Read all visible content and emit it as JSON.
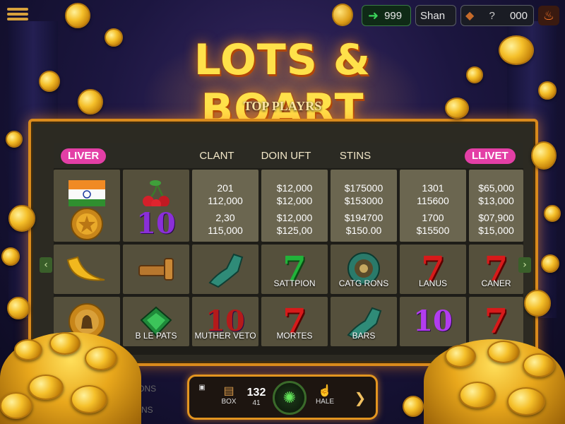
{
  "topbar": {
    "balance": "999",
    "player_name": "Shan",
    "help": "?",
    "gems": "000"
  },
  "title": "LOTS & BOART",
  "subtitle": "TOP PLAYRS",
  "board": {
    "header": {
      "left_tag": "LIVER",
      "columns": [
        "CLANT",
        "DOIN UFT",
        "STINS"
      ],
      "right_tag": "LLIVET"
    },
    "value_rows": [
      {
        "values": [
          [
            "201",
            "112,000"
          ],
          [
            "$12,000",
            "$12,000"
          ],
          [
            "$175000",
            "$153000"
          ],
          [
            "1301",
            "115600"
          ],
          [
            "$65,000",
            "$13,000"
          ]
        ]
      },
      {
        "values": [
          [
            "2,30",
            "115,000"
          ],
          [
            "$12,000",
            "$125,00"
          ],
          [
            "$194700",
            "$150.00"
          ],
          [
            "1700",
            "$15500"
          ],
          [
            "$07,900",
            "$15,000"
          ]
        ]
      }
    ],
    "symbol_rows": [
      [
        {
          "symbol": "banana-icon",
          "caption": ""
        },
        {
          "symbol": "horn-icon",
          "caption": ""
        },
        {
          "symbol": "pipe-icon",
          "caption": ""
        },
        {
          "symbol": "7",
          "style": "grn7",
          "caption": "SATTPION"
        },
        {
          "symbol": "medallion-icon",
          "caption": "CATG RONS"
        },
        {
          "symbol": "7",
          "style": "red7",
          "caption": "LANUS"
        },
        {
          "symbol": "7",
          "style": "red7",
          "caption": "CANER"
        }
      ],
      [
        {
          "symbol": "bell-coin-icon",
          "caption": ""
        },
        {
          "symbol": "emerald-icon",
          "caption": "B LE PATS"
        },
        {
          "symbol": "10",
          "style": "ten red",
          "caption": "MUTHER VETO"
        },
        {
          "symbol": "7",
          "style": "red7",
          "caption": "MORTES"
        },
        {
          "symbol": "pipe-icon",
          "caption": "BARS"
        },
        {
          "symbol": "10",
          "style": "ten pur",
          "caption": ""
        },
        {
          "symbol": "7",
          "style": "red7",
          "caption": ""
        }
      ]
    ],
    "icon_column": {
      "row1": [
        "india-flag-icon",
        "cherries-icon"
      ],
      "row2": [
        "star-coin-icon",
        "10"
      ]
    }
  },
  "bottombar": {
    "left_label": "BOX",
    "count": "132",
    "count_sub": "41",
    "right_label": "HALE"
  },
  "faint": {
    "left": "TONS",
    "left2": "NS"
  },
  "colors": {
    "accent": "#e39520",
    "tag": "#e33fa6",
    "red7": "#d71a1a",
    "green7": "#21b33a"
  }
}
